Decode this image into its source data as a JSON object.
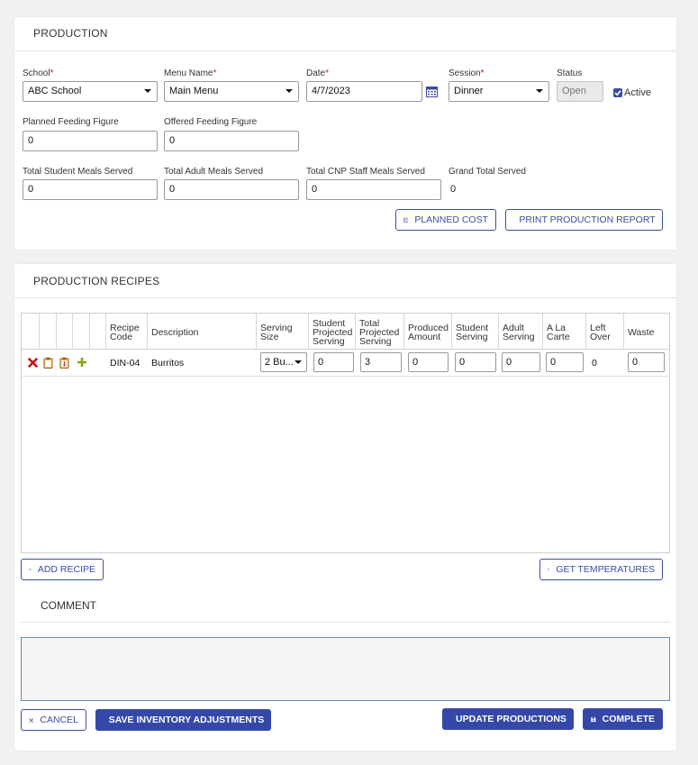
{
  "production": {
    "title": "PRODUCTION",
    "school": {
      "label": "School",
      "value": "ABC School"
    },
    "menu_name": {
      "label": "Menu Name",
      "value": "Main Menu"
    },
    "date": {
      "label": "Date",
      "value": "4/7/2023"
    },
    "session": {
      "label": "Session",
      "value": "Dinner"
    },
    "status": {
      "label": "Status",
      "value": "Open"
    },
    "active": {
      "label": "Active",
      "checked": true
    },
    "required_mark": "*",
    "planned_feeding": {
      "label": "Planned Feeding Figure",
      "value": "0"
    },
    "offered_feeding": {
      "label": "Offered Feeding Figure",
      "value": "0"
    },
    "total_student": {
      "label": "Total Student Meals Served",
      "value": "0"
    },
    "total_adult": {
      "label": "Total Adult Meals Served",
      "value": "0"
    },
    "total_cnp": {
      "label": "Total CNP Staff Meals Served",
      "value": "0"
    },
    "grand_total": {
      "label": "Grand Total Served",
      "value": "0"
    },
    "planned_cost_button": "PLANNED COST",
    "print_report_button": "PRINT PRODUCTION REPORT"
  },
  "recipes": {
    "title": "PRODUCTION RECIPES",
    "columns": {
      "recipe_code": [
        "Recipe",
        "Code"
      ],
      "description": "Description",
      "serving_size": [
        "Serving",
        "Size"
      ],
      "student_projected": [
        "Student",
        "Projected",
        "Serving"
      ],
      "total_projected": [
        "Total",
        "Projected",
        "Serving"
      ],
      "produced_amount": [
        "Produced",
        "Amount"
      ],
      "student_serving": [
        "Student",
        "Serving"
      ],
      "adult_serving": [
        "Adult",
        "Serving"
      ],
      "a_la_carte": [
        "A La",
        "Carte"
      ],
      "left_over": [
        "Left",
        "Over"
      ],
      "waste": "Waste"
    },
    "rows": [
      {
        "recipe_code": "DIN-04",
        "description": "Burritos",
        "serving_size": "2 Bu...",
        "student_projected": "0",
        "total_projected": "3",
        "produced_amount": "0",
        "student_serving": "0",
        "adult_serving": "0",
        "a_la_carte": "0",
        "left_over": "0",
        "waste": "0"
      }
    ],
    "add_recipe_button": "ADD RECIPE",
    "get_temperatures_button": "GET TEMPERATURES"
  },
  "comment": {
    "title": "COMMENT",
    "value": ""
  },
  "footer": {
    "cancel_button": "CANCEL",
    "save_inventory_button": "SAVE INVENTORY ADJUSTMENTS",
    "update_productions_button": "UPDATE PRODUCTIONS",
    "complete_button": "COMPLETE"
  },
  "colors": {
    "accent": "#3548a8",
    "required": "#dd1111",
    "delete_icon": "#cc1111",
    "add_icon": "#8aa21a"
  }
}
